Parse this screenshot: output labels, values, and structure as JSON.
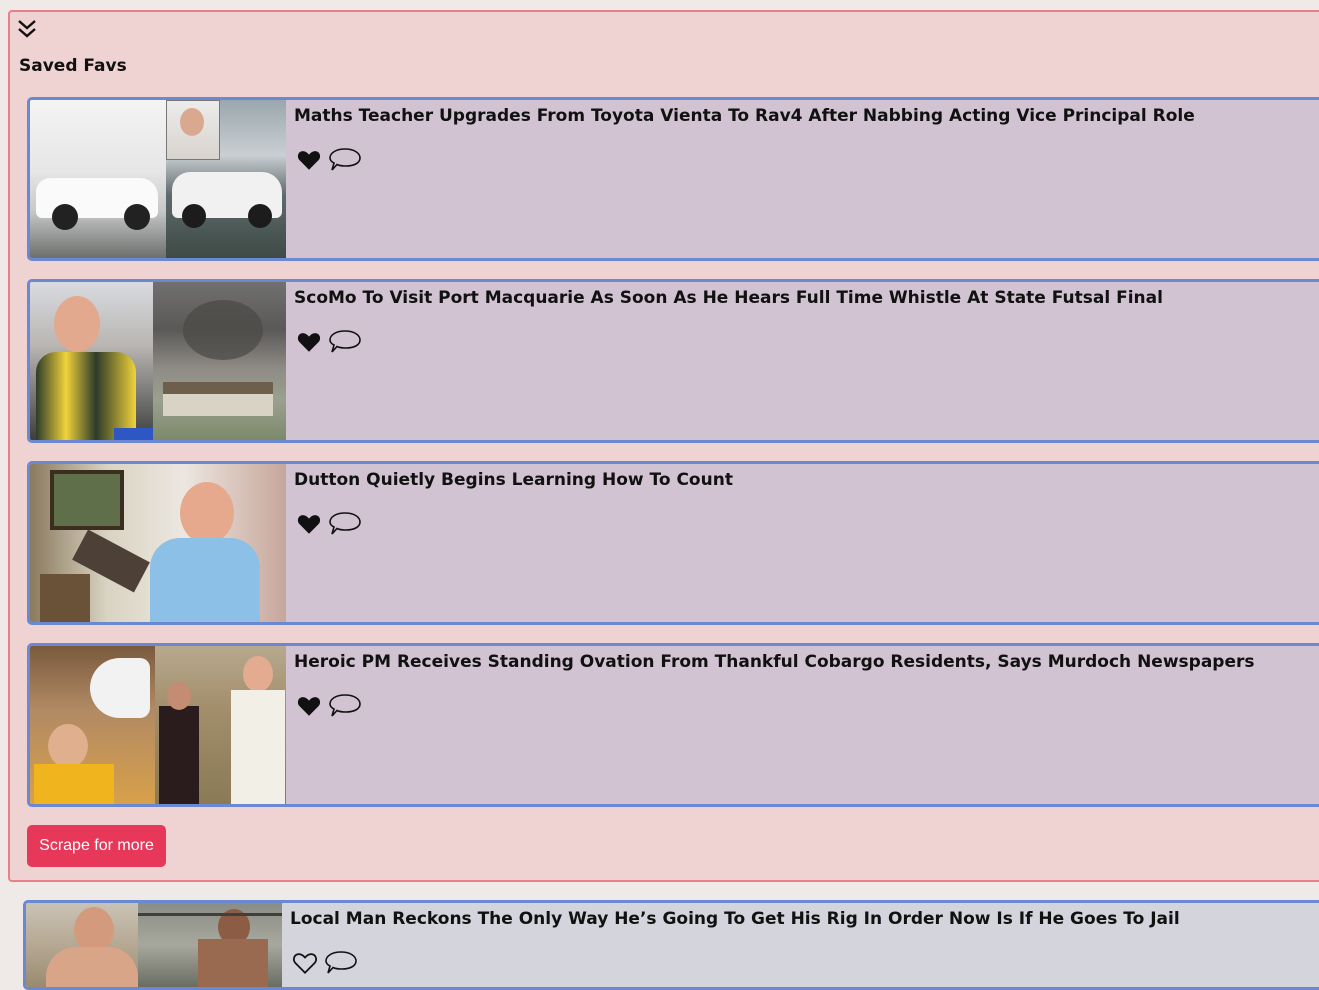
{
  "favs": {
    "title": "Saved Favs",
    "scrape_label": "Scrape for more",
    "articles": [
      {
        "title": "Maths Teacher Upgrades From Toyota Vienta To Rav4 After Nabbing Acting Vice Principal Role",
        "liked": true
      },
      {
        "title": "ScoMo To Visit Port Macquarie As Soon As He Hears Full Time Whistle At State Futsal Final",
        "liked": true
      },
      {
        "title": "Dutton Quietly Begins Learning How To Count",
        "liked": true
      },
      {
        "title": "Heroic PM Receives Standing Ovation From Thankful Cobargo Residents, Says Murdoch Newspapers",
        "liked": true
      }
    ]
  },
  "feed": {
    "articles": [
      {
        "title": "Local Man Reckons The Only Way He’s Going To Get His Rig In Order Now Is If He Goes To Jail",
        "liked": false
      }
    ]
  },
  "colors": {
    "panel_bg": "#efd3d2",
    "panel_border": "#e8808a",
    "card_bg": "#d2c3d3",
    "card_border": "#6b88d2",
    "button_bg": "#e8385a"
  },
  "icons": {
    "collapse": "double-chevron-down-icon",
    "like_filled": "heart-filled-icon",
    "like_outline": "heart-outline-icon",
    "comment": "speech-bubble-icon"
  }
}
